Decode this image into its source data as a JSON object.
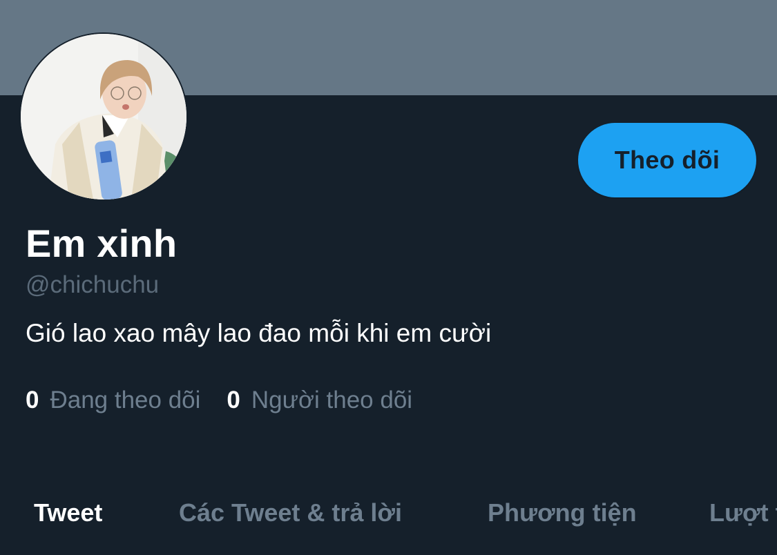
{
  "header": {
    "banner_color": "#657786"
  },
  "profile": {
    "display_name": "Em xinh",
    "handle": "@chichuchu",
    "bio": "Gió lao xao mây lao đao mỗi khi em cười",
    "avatar_icon": "profile-photo"
  },
  "actions": {
    "follow_label": "Theo dõi",
    "follow_color": "#1da1f2"
  },
  "stats": {
    "following_count": "0",
    "following_label": "Đang theo dõi",
    "followers_count": "0",
    "followers_label": "Người theo dõi"
  },
  "tabs": [
    {
      "label": "Tweet",
      "active": true
    },
    {
      "label": "Các Tweet & trả lời",
      "active": false
    },
    {
      "label": "Phương tiện",
      "active": false
    },
    {
      "label": "Lượt thích",
      "active": false
    }
  ]
}
